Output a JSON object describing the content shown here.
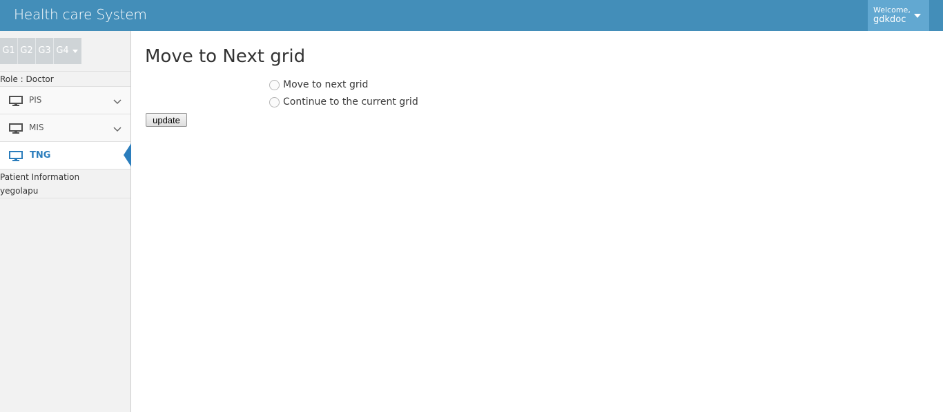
{
  "header": {
    "brand": "Health care System",
    "welcome": "Welcome,",
    "user": "gdkdoc"
  },
  "sidebar": {
    "shortcuts": [
      "G1",
      "G2",
      "G3",
      "G4"
    ],
    "role": "Role : Doctor",
    "items": [
      {
        "label": "PIS",
        "icon": "monitor-icon",
        "expandable": true
      },
      {
        "label": "MIS",
        "icon": "monitor-icon",
        "expandable": true
      },
      {
        "label": "TNG",
        "icon": "monitor-icon",
        "active": true
      }
    ],
    "patient": {
      "title": "Patient Information",
      "name": "yegolapu"
    }
  },
  "main": {
    "title": "Move to Next grid",
    "options": [
      "Move to next grid",
      "Continue to the current grid"
    ],
    "update_label": "update"
  },
  "colors": {
    "navbar": "#438eb9",
    "user_menu": "#62a8d1",
    "active": "#2b7dbc"
  }
}
